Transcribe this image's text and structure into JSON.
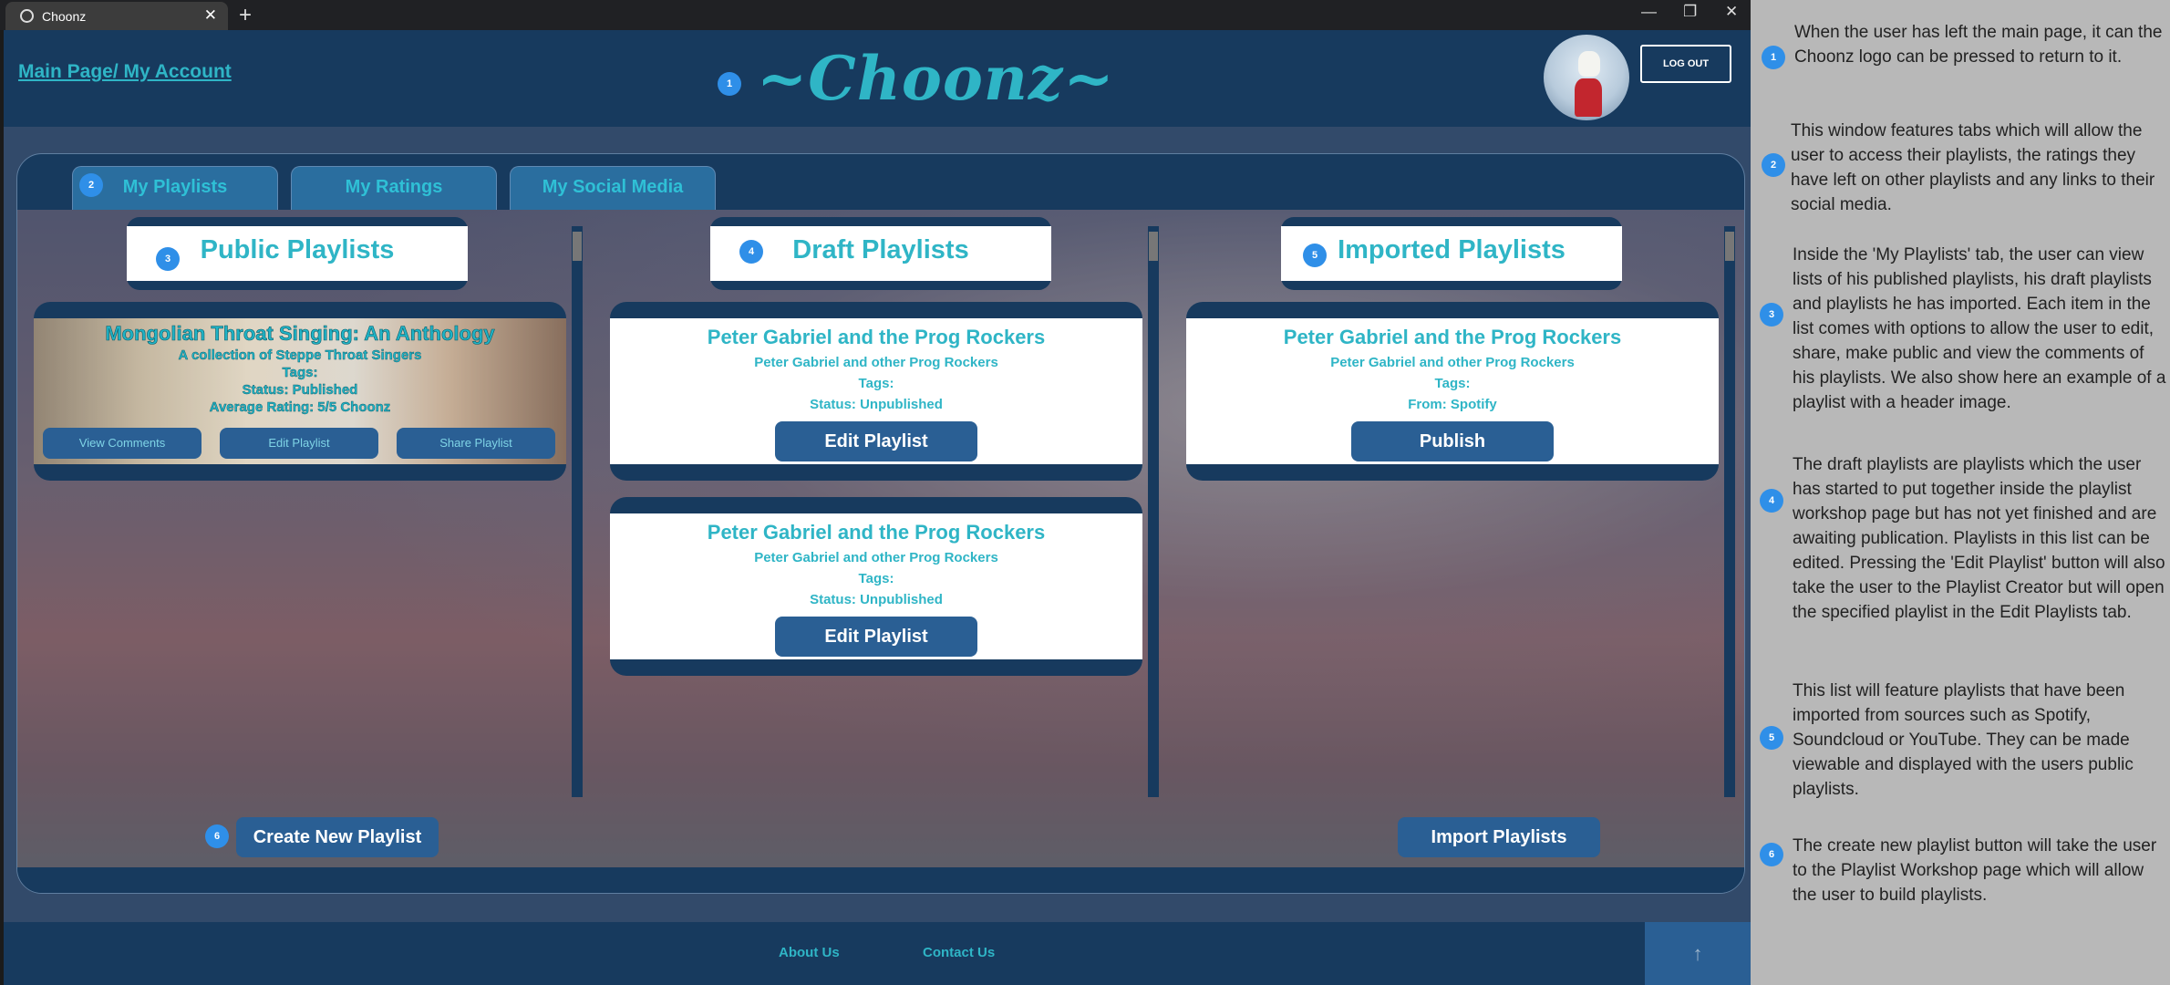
{
  "browser": {
    "tab_title": "Choonz",
    "new_tab": "+",
    "close_tab": "✕",
    "minimize": "—",
    "restore": "❐",
    "close_window": "✕"
  },
  "header": {
    "main_link": "Main Page/ My Account",
    "logo": "~Choonz~",
    "logout": "LOG OUT"
  },
  "tabs": [
    "My Playlists",
    "My Ratings",
    "My Social Media"
  ],
  "columns": {
    "public": {
      "title": "Public Playlists",
      "card": {
        "title": "Mongolian Throat Singing: An Anthology",
        "subtitle": "A collection of Steppe Throat Singers",
        "tags": "Tags:",
        "status": "Status: Published",
        "rating": "Average Rating: 5/5 Choonz",
        "buttons": [
          "View Comments",
          "Edit Playlist",
          "Share Playlist"
        ]
      }
    },
    "draft": {
      "title": "Draft Playlists",
      "cards": [
        {
          "title": "Peter Gabriel and the Prog Rockers",
          "subtitle": "Peter Gabriel and other Prog Rockers",
          "tags": "Tags:",
          "status": "Status: Unpublished",
          "button": "Edit Playlist"
        },
        {
          "title": "Peter Gabriel and the Prog Rockers",
          "subtitle": "Peter Gabriel and other Prog Rockers",
          "tags": "Tags:",
          "status": "Status: Unpublished",
          "button": "Edit Playlist"
        }
      ]
    },
    "imported": {
      "title": "Imported Playlists",
      "card": {
        "title": "Peter Gabriel and the Prog Rockers",
        "subtitle": "Peter Gabriel and other Prog Rockers",
        "tags": "Tags:",
        "source": "From: Spotify",
        "button": "Publish"
      }
    }
  },
  "actions": {
    "create": "Create New Playlist",
    "import": "Import Playlists"
  },
  "footer": {
    "about": "About Us",
    "contact": "Contact Us",
    "to_top": "↑"
  },
  "markers": [
    "1",
    "2",
    "3",
    "4",
    "5",
    "6"
  ],
  "notes": [
    {
      "num": "1",
      "text": "When the user has left the main page, it can the Choonz logo can be pressed to return to it."
    },
    {
      "num": "2",
      "text": "This window features tabs which will allow the user to access their playlists, the ratings they have left on other playlists and any links to their social media."
    },
    {
      "num": "3",
      "text": "Inside the 'My Playlists' tab, the user can view lists of his published playlists, his draft playlists and playlists he has imported. Each item in the list comes with options to allow the user to edit, share, make public and view the comments of his playlists.  We also show here an example of a playlist with a header image."
    },
    {
      "num": "4",
      "text": "The draft playlists are playlists which the user has started to put together inside the playlist workshop page but has not yet finished and are awaiting publication. Playlists in this list can be edited. Pressing the 'Edit Playlist' button will also take the user to the Playlist Creator but will open the specified playlist in the Edit Playlists tab."
    },
    {
      "num": "5",
      "text": "This list will feature playlists that have been imported from sources such as Spotify, Soundcloud or YouTube.  They can be made viewable and displayed with the users public playlists."
    },
    {
      "num": "6",
      "text": "The create new playlist button will take the user to the Playlist Workshop page which will allow the user to build playlists."
    }
  ]
}
